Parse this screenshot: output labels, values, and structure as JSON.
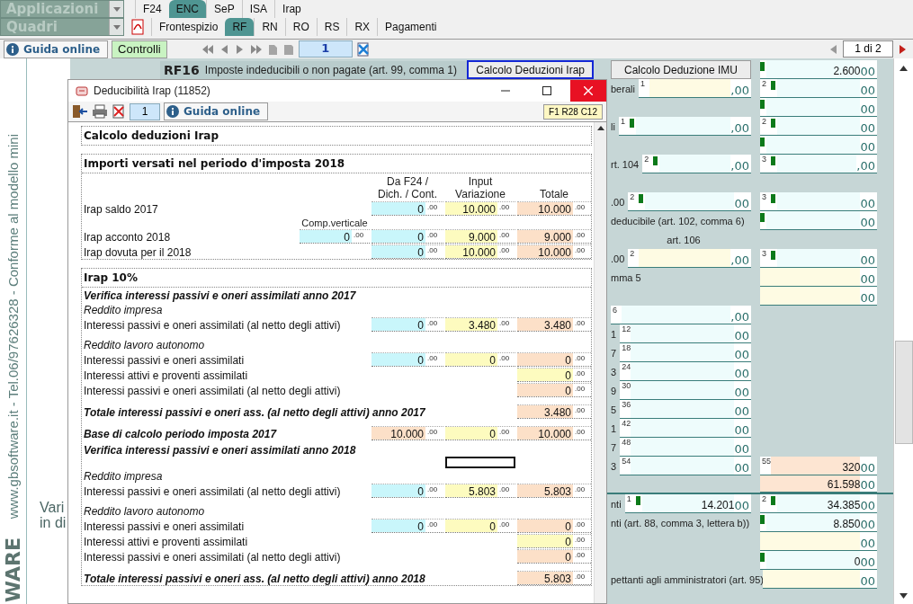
{
  "menu": {
    "applications": {
      "label": "Applicazioni"
    },
    "app_tabs": [
      {
        "label": "F24",
        "selected": false
      },
      {
        "label": "ENC",
        "selected": true
      },
      {
        "label": "SeP",
        "selected": false
      },
      {
        "label": "ISA",
        "selected": false
      },
      {
        "label": "Irap",
        "selected": false
      }
    ],
    "quadri": {
      "label": "Quadri"
    },
    "quadri_tabs": [
      {
        "label": "Frontespizio",
        "selected": false
      },
      {
        "label": "RF",
        "selected": true
      },
      {
        "label": "RN",
        "selected": false
      },
      {
        "label": "RO",
        "selected": false
      },
      {
        "label": "RS",
        "selected": false
      },
      {
        "label": "RX",
        "selected": false
      },
      {
        "label": "Pagamenti",
        "selected": false
      }
    ]
  },
  "toolbar": {
    "help_button": "Guida online",
    "controls_button": "Controlli",
    "page": "1",
    "page_count": "1 di 2"
  },
  "sidebar": {
    "site_text": "www.gbsoftware.it - Tel.06/97626328 - Conforme al modello mini",
    "brand": "WARE",
    "fragments": [
      "Vari",
      "in di"
    ]
  },
  "form": {
    "header": {
      "code": "RF16",
      "title": "Imposte indeducibili o non pagate (art. 99, comma 1)",
      "buttons": [
        {
          "label": "Calcolo Deduzioni Irap",
          "focused": true
        },
        {
          "label": "Calcolo Deduzione IMU",
          "focused": false
        }
      ],
      "field": {
        "flag": true,
        "value": "2.600",
        "suffix": "00",
        "color": "#eefcfc"
      }
    },
    "rows": [
      {
        "label": "berali",
        "a": {
          "num": "1",
          "flag": false,
          "suffix": ",00",
          "color": "#fefbe3"
        },
        "b": {
          "num": "2",
          "flag": true,
          "suffix": "00",
          "color": "#eefcfc"
        }
      },
      {
        "b": {
          "flag": true,
          "suffix": "00",
          "color": "#eefcfc"
        }
      },
      {
        "label": "li",
        "a": {
          "num": "1",
          "flag": true,
          "suffix": ",00",
          "color": "#eefcfc"
        },
        "b": {
          "num": "2",
          "flag": true,
          "suffix": "00",
          "color": "#eefcfc"
        }
      },
      {
        "b": {
          "flag": true,
          "suffix": "00",
          "color": "#eefcfc"
        }
      },
      {
        "label": "rt. 104",
        "a": {
          "num": "2",
          "flag": true,
          "suffix": ",00",
          "color": "#eefcfc"
        },
        "b": {
          "num": "3",
          "flag": true,
          "suffix": ",00",
          "color": "#eefcfc"
        }
      },
      {
        "kind": "blank"
      },
      {
        "label": ".00",
        "a": {
          "num": "2",
          "flag": true,
          "suffix": "00",
          "color": "#eefcfc"
        },
        "b": {
          "num": "3",
          "flag": true,
          "suffix": "00",
          "color": "#eefcfc"
        }
      },
      {
        "label": "deducibile (art. 102, comma 6)",
        "b": {
          "flag": true,
          "suffix": "00",
          "color": "#eefcfc"
        }
      },
      {
        "kind": "caption",
        "label": "art. 106"
      },
      {
        "label": ".00",
        "a": {
          "num": "2",
          "flag": false,
          "suffix": ",00",
          "color": "#fefbe3"
        },
        "b": {
          "num": "3",
          "flag": true,
          "suffix": "00",
          "color": "#eefcfc"
        }
      },
      {
        "label": "mma 5",
        "b": {
          "flag": false,
          "suffix": "00",
          "color": "#fefbe3"
        }
      },
      {
        "b": {
          "flag": false,
          "suffix": "00",
          "color": "#fefbe3"
        }
      },
      {
        "a": {
          "num": "6",
          "flag": false,
          "suffix": ",00",
          "color": "#eefcfc"
        }
      },
      {
        "label": "1",
        "a": {
          "num": "12",
          "flag": false,
          "suffix": "00",
          "color": "#eefcfc"
        }
      },
      {
        "label": "7",
        "a": {
          "num": "18",
          "flag": false,
          "suffix": "00",
          "color": "#eefcfc"
        }
      },
      {
        "label": "3",
        "a": {
          "num": "24",
          "flag": false,
          "suffix": "00",
          "color": "#eefcfc"
        }
      },
      {
        "label": "9",
        "a": {
          "num": "30",
          "flag": false,
          "suffix": "00",
          "color": "#eefcfc"
        }
      },
      {
        "label": "5",
        "a": {
          "num": "36",
          "flag": false,
          "suffix": "00",
          "color": "#eefcfc"
        }
      },
      {
        "label": "1",
        "a": {
          "num": "42",
          "flag": false,
          "suffix": "00",
          "color": "#eefcfc"
        }
      },
      {
        "label": "7",
        "a": {
          "num": "48",
          "flag": false,
          "suffix": "00",
          "color": "#eefcfc"
        }
      },
      {
        "label": "3",
        "a": {
          "num": "54",
          "flag": false,
          "suffix": "00",
          "color": "#eefcfc"
        },
        "b": {
          "num": "55",
          "flag": false,
          "value": "320",
          "suffix": "00",
          "color": "#fde5d2"
        }
      },
      {
        "b": {
          "flag": false,
          "value": "61.598",
          "suffix": "00",
          "color": "#fde5d2"
        }
      },
      {
        "label": "nti",
        "a": {
          "num": "1",
          "flag": true,
          "value": "14.201",
          "suffix": "00",
          "color": "#eefcfc"
        },
        "b": {
          "num": "2",
          "flag": true,
          "value": "34.385",
          "suffix": "00",
          "color": "#eefcfc"
        }
      },
      {
        "label": "nti (art. 88, comma 3, lettera b))",
        "b": {
          "flag": true,
          "value": "8.850",
          "suffix": "00",
          "color": "#eefcfc"
        }
      },
      {
        "b": {
          "flag": false,
          "suffix": "00",
          "color": "#fefbe3"
        }
      },
      {
        "b": {
          "flag": true,
          "value": "0",
          "suffix": "00",
          "color": "#eefcfc"
        }
      },
      {
        "label": "pettanti agli amministratori (art. 95)",
        "b": {
          "flag": false,
          "suffix": "00",
          "color": "#fefbe3"
        }
      }
    ]
  },
  "dialog": {
    "title": "Deducibilità Irap (11852)",
    "page": "1",
    "help_button": "Guida online",
    "cell_ref": "F1 R28 C12",
    "sections": [
      {
        "title": "Calcolo deduzioni Irap"
      },
      {
        "title": "Importi versati nel periodo d'imposta 2018",
        "columns": [
          {
            "kind": "f24",
            "label": "Da F24 /\nDich. / Cont."
          },
          {
            "kind": "input",
            "label": "Input\nVariazione"
          },
          {
            "kind": "total",
            "label": "Totale"
          }
        ],
        "rows": [
          {
            "kind": "row",
            "label": "Irap saldo 2017",
            "cells": [
              {
                "kind": "f24",
                "value": "0",
                "suffix": ".00",
                "color": "#c9f6fb"
              },
              {
                "kind": "input",
                "value": "10.000",
                "suffix": ".00",
                "color": "#fdfbbf"
              },
              {
                "kind": "total",
                "value": "10.000",
                "suffix": ".00",
                "color": "#fce0c8"
              }
            ]
          },
          {
            "kind": "row",
            "label": "Irap acconto 2018",
            "comp_verticale": {
              "label": "Comp.verticale",
              "value": "0",
              "suffix": ".00",
              "color": "#c9f6fb"
            },
            "cells": [
              {
                "kind": "f24",
                "value": "0",
                "suffix": ".00",
                "color": "#c9f6fb"
              },
              {
                "kind": "input",
                "value": "9.000",
                "suffix": ".00",
                "color": "#fdfbbf"
              },
              {
                "kind": "total",
                "value": "9.000",
                "suffix": ".00",
                "color": "#fce0c8"
              }
            ]
          },
          {
            "kind": "row",
            "label": "Irap dovuta per il 2018",
            "cells": [
              {
                "kind": "f24",
                "value": "0",
                "suffix": ".00",
                "color": "#c9f6fb"
              },
              {
                "kind": "input",
                "value": "10.000",
                "suffix": ".00",
                "color": "#fdfbbf"
              },
              {
                "kind": "total",
                "value": "10.000",
                "suffix": ".00",
                "color": "#fce0c8"
              }
            ]
          }
        ]
      },
      {
        "title": "Irap 10%",
        "rows": [
          {
            "kind": "heading",
            "label": "Verifica interessi passivi e oneri assimilati anno 2017"
          },
          {
            "kind": "sub",
            "label": "Reddito impresa"
          },
          {
            "kind": "row",
            "label": "Interessi passivi e oneri assimilati (al netto degli attivi)",
            "cells": [
              {
                "kind": "f24",
                "value": "0",
                "suffix": ".00",
                "color": "#c9f6fb"
              },
              {
                "kind": "input",
                "value": "3.480",
                "suffix": ".00",
                "color": "#fdfbbf"
              },
              {
                "kind": "total",
                "value": "3.480",
                "suffix": ".00",
                "color": "#fce0c8"
              }
            ]
          },
          {
            "kind": "sub",
            "label": "Reddito lavoro autonomo"
          },
          {
            "kind": "row",
            "label": "Interessi passivi e oneri assimilati",
            "cells": [
              {
                "kind": "f24",
                "value": "0",
                "suffix": ".00",
                "color": "#c9f6fb"
              },
              {
                "kind": "input",
                "value": "0",
                "suffix": ".00",
                "color": "#fdfbbf"
              },
              {
                "kind": "total",
                "value": "0",
                "suffix": ".00",
                "color": "#fce0c8"
              }
            ]
          },
          {
            "kind": "row",
            "label": "Interessi attivi e proventi assimilati",
            "cells": [
              {
                "kind": "total",
                "value": "0",
                "suffix": ".00",
                "color": "#fdfbbf"
              }
            ]
          },
          {
            "kind": "row",
            "label": "Interessi passivi e oneri assimilati (al netto degli attivi)",
            "cells": [
              {
                "kind": "total",
                "value": "0",
                "suffix": ".00",
                "color": "#fce0c8"
              }
            ]
          },
          {
            "kind": "total",
            "label": "Totale interessi passivi e oneri ass. (al netto degli attivi) anno 2017",
            "cells": [
              {
                "kind": "total",
                "value": "3.480",
                "suffix": ".00",
                "color": "#fce0c8"
              }
            ]
          },
          {
            "kind": "total",
            "label": "Base di calcolo periodo imposta 2017",
            "cells": [
              {
                "kind": "f24",
                "value": "10.000",
                "suffix": ".00",
                "color": "#fce0c8"
              },
              {
                "kind": "input",
                "value": "0",
                "suffix": ".00",
                "color": "#fdfbbf"
              },
              {
                "kind": "total",
                "value": "10.000",
                "suffix": ".00",
                "color": "#fce0c8"
              }
            ]
          },
          {
            "kind": "heading",
            "label": "Verifica interessi passivi e oneri assimilati anno 2018",
            "marker_box": true
          },
          {
            "kind": "sub",
            "label": "Reddito impresa"
          },
          {
            "kind": "row",
            "label": "Interessi passivi e oneri assimilati (al netto degli attivi)",
            "cells": [
              {
                "kind": "f24",
                "value": "0",
                "suffix": ".00",
                "color": "#c9f6fb"
              },
              {
                "kind": "input",
                "value": "5.803",
                "suffix": ".00",
                "color": "#fdfbbf"
              },
              {
                "kind": "total",
                "value": "5.803",
                "suffix": ".00",
                "color": "#fce0c8"
              }
            ]
          },
          {
            "kind": "sub",
            "label": "Reddito lavoro autonomo"
          },
          {
            "kind": "row",
            "label": "Interessi passivi e oneri assimilati",
            "cells": [
              {
                "kind": "f24",
                "value": "0",
                "suffix": ".00",
                "color": "#c9f6fb"
              },
              {
                "kind": "input",
                "value": "0",
                "suffix": ".00",
                "color": "#fdfbbf"
              },
              {
                "kind": "total",
                "value": "0",
                "suffix": ".00",
                "color": "#fce0c8"
              }
            ]
          },
          {
            "kind": "row",
            "label": "Interessi attivi e proventi assimilati",
            "cells": [
              {
                "kind": "total",
                "value": "0",
                "suffix": ".00",
                "color": "#fdfbbf"
              }
            ]
          },
          {
            "kind": "row",
            "label": "Interessi passivi e oneri assimilati (al netto degli attivi)",
            "cells": [
              {
                "kind": "total",
                "value": "0",
                "suffix": ".00",
                "color": "#fce0c8"
              }
            ]
          },
          {
            "kind": "total",
            "label": "Totale interessi passivi e oneri ass. (al netto degli attivi) anno 2018",
            "cells": [
              {
                "kind": "total",
                "value": "5.803",
                "suffix": ".00",
                "color": "#fce0c8"
              }
            ]
          }
        ]
      }
    ]
  }
}
